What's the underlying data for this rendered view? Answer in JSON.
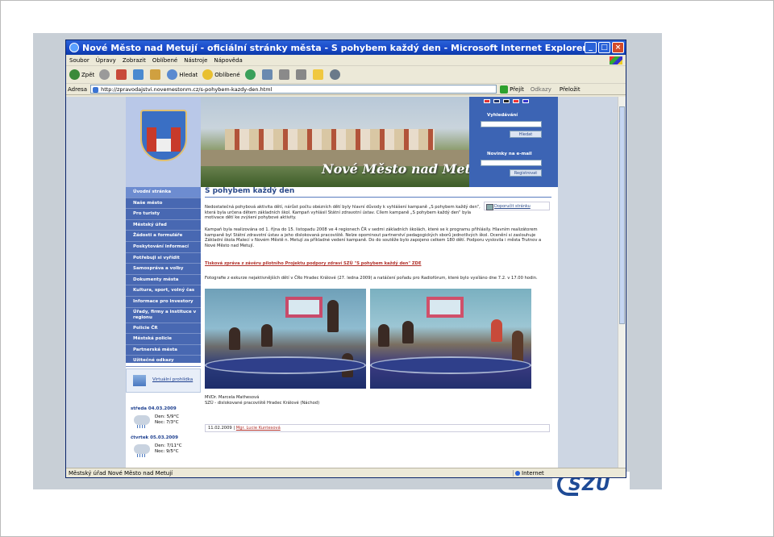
{
  "window": {
    "title": "Nové Město nad Metují - oficiální stránky města - S pohybem každý den - Microsoft Internet Explorer",
    "menu": [
      "Soubor",
      "Úpravy",
      "Zobrazit",
      "Oblíbené",
      "Nástroje",
      "Nápověda"
    ],
    "toolbar": {
      "back": "Zpět",
      "search": "Hledat",
      "favorites": "Oblíbené"
    },
    "address_label": "Adresa",
    "url": "http://zpravodajstvi.novemestonm.cz/s-pohybem-kazdy-den.html",
    "go": "Přejít",
    "links": "Odkazy",
    "translate": "Přeložit",
    "status": "Městský úřad Nové Město nad Metují",
    "zone": "Internet"
  },
  "banner": {
    "title": "Nové Město nad Metují"
  },
  "right_panel": {
    "search_label": "Vyhledávání",
    "search_button": "Hledat",
    "news_label": "Novinky na e-mail",
    "register_button": "Registrovat"
  },
  "nav": [
    "Úvodní stránka",
    "Naše město",
    "Pro turisty",
    "Městský úřad",
    "Žádosti a formuláře",
    "Poskytování informací",
    "Potřebuji si vyřídit",
    "Samospráva a volby",
    "Dokumenty města",
    "Kultura, sport, volný čas",
    "Informace pro investory",
    "Úřady, firmy a instituce v regionu",
    "Policie ČR",
    "Městská policie",
    "Partnerská města",
    "Užitečné odkazy"
  ],
  "virtual_tour": "Virtuální prohlídka",
  "weather": [
    {
      "day": "středa 04.03.2009",
      "day_t": "Den: 5/9°C",
      "night_t": "Noc: 7/3°C"
    },
    {
      "day": "čtvrtek 05.03.2009",
      "day_t": "Den: 7/11°C",
      "night_t": "Noc: 9/5°C"
    }
  ],
  "article": {
    "heading": "S pohybem každý den",
    "print": "Doporučit stránku",
    "p1": "Nedostatečná pohybová aktivita dětí, nárůst počtu obézních dětí byly hlavní důvody k vyhlášení kampaně „S pohybem každý den“, která byla určena dětem základních škol. Kampaň vyhlásil Státní zdravotní ústav. Cílem kampaně „S pohybem každý den“ byla motivace dětí ke zvýšení pohybové aktivity.",
    "p2": "Kampaň byla realizována od 1. října do 15. listopadu 2008 ve 4 regionech ČR v sedmi základních školách, které se k programu přihlásily. Hlavním realizátorem kampaně byl Státní zdravotní ústav a jeho dislokovaná pracoviště. Nelze opominout partnerství pedagogických sborů jednotlivých škol. Ocenění si zaslouhuje Základní škola Malecí v Novém Městě n. Metují za příkladné vedení kampaně. Do do soutěže bylo zapojeno celkem 180 dětí. Podporu vyslovila i města Trutnov a Nové Město nad Metují.",
    "press_link": "Tisková zpráva z závěru pilotního Projektu podpory zdraví SZÚ \"S pohybem každý den\" ZDE",
    "p3": "Fotografie z exkurze nejaktivnějších dětí v ČRo Hradec Králové (27. ledna 2009) a natáčení pořadu pro Radiofórum, které bylo vysíláno dne 7.2. v 17.00 hodin.",
    "sig1": "MVDr. Marcela Mathesová",
    "sig2": "SZÚ - dislokované pracoviště Hradec Králové (Náchod)",
    "date": "11.02.2009 |",
    "author": "Mgr. Lucie Kuntesová"
  },
  "logo_text": "SZU"
}
